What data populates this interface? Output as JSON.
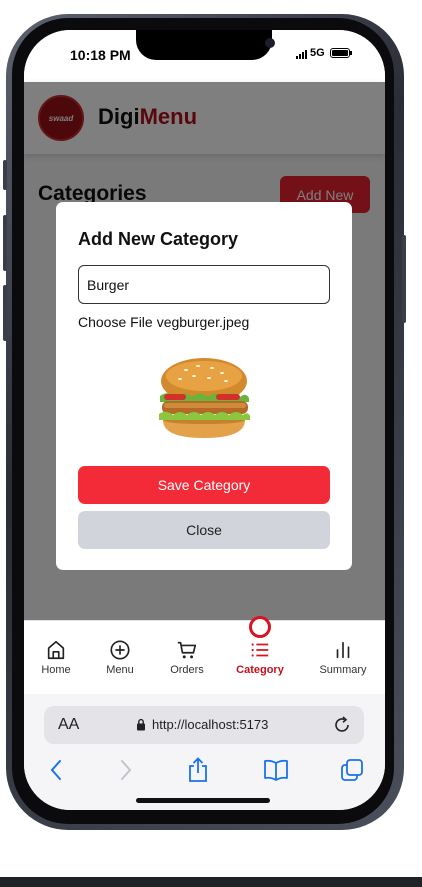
{
  "status": {
    "time": "10:18 PM",
    "network": "5G"
  },
  "app": {
    "brand_part1": "Digi",
    "brand_part2": "Menu",
    "logo_text": "swaad",
    "page_title": "Categories",
    "add_new_label": "Add New"
  },
  "modal": {
    "title": "Add New Category",
    "name_value": "Burger",
    "file_button_label": "Choose File",
    "file_name": "vegburger.jpeg",
    "save_label": "Save Category",
    "close_label": "Close"
  },
  "nav": {
    "items": [
      {
        "label": "Home",
        "icon": "home-icon"
      },
      {
        "label": "Menu",
        "icon": "plus-circle-icon"
      },
      {
        "label": "Orders",
        "icon": "cart-icon"
      },
      {
        "label": "Category",
        "icon": "list-icon"
      },
      {
        "label": "Summary",
        "icon": "bar-chart-icon"
      }
    ],
    "active": "Category"
  },
  "browser": {
    "aa_label": "AA",
    "url": "http://localhost:5173"
  },
  "colors": {
    "accent": "#e8212f",
    "brand_dark": "#b0101a",
    "active_nav": "#c8101b"
  }
}
